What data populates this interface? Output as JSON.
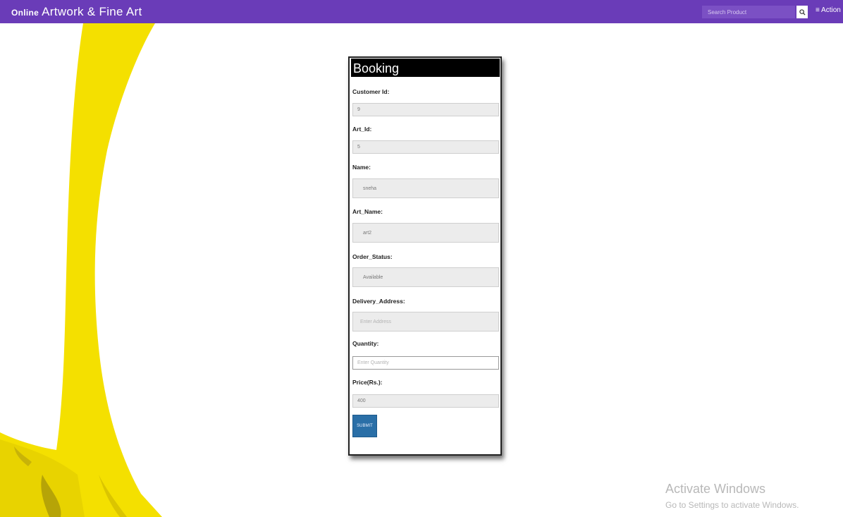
{
  "header": {
    "brand_bold": "Online",
    "brand_rest": "Artwork & Fine Art",
    "search_placeholder": "Search Product",
    "action_label": "≡ Action"
  },
  "form": {
    "title": "Booking",
    "fields": [
      {
        "label": "Customer Id:",
        "value": "9",
        "placeholder": ""
      },
      {
        "label": "Art_Id:",
        "value": "5",
        "placeholder": ""
      },
      {
        "label": "Name:",
        "value": "sneha",
        "placeholder": ""
      },
      {
        "label": "Art_Name:",
        "value": "art2",
        "placeholder": ""
      },
      {
        "label": "Order_Status:",
        "value": "Available",
        "placeholder": ""
      },
      {
        "label": "Delivery_Address:",
        "value": "",
        "placeholder": "Enter Address"
      },
      {
        "label": "Quantity:",
        "value": "",
        "placeholder": "Enter Quantity"
      },
      {
        "label": "Price(Rs.):",
        "value": "400",
        "placeholder": ""
      }
    ],
    "submit_label": "SUBMIT"
  },
  "watermark": {
    "line1": "Activate Windows",
    "line2": "Go to Settings to activate Windows."
  }
}
